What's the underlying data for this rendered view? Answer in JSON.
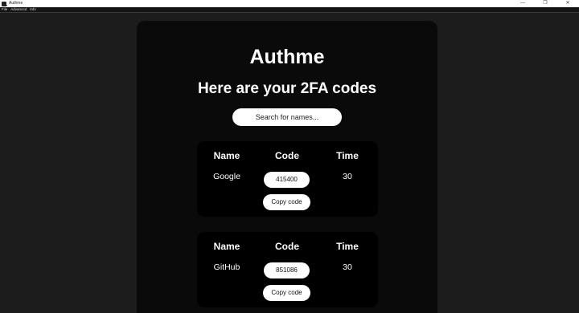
{
  "window": {
    "title": "Authme",
    "icon": "magnifier-icon",
    "controls": {
      "minimize": "—",
      "maximize": "❐",
      "close": "✕"
    }
  },
  "menu": {
    "items": [
      "File",
      "Advanced",
      "Info"
    ]
  },
  "main": {
    "heading": "Authme",
    "subheading": "Here are your 2FA codes",
    "search": {
      "placeholder": "Search for names...",
      "value": ""
    },
    "columns": {
      "name": "Name",
      "code": "Code",
      "time": "Time"
    },
    "copy_label": "Copy code",
    "entries": [
      {
        "name": "Google",
        "code": "415400",
        "time": "30"
      },
      {
        "name": "GitHub",
        "code": "851086",
        "time": "30"
      }
    ]
  },
  "colors": {
    "background": "#1c1c1c",
    "panel": "#0a0a0a",
    "card": "#000000",
    "text": "#ffffff",
    "pill": "#ffffff"
  }
}
